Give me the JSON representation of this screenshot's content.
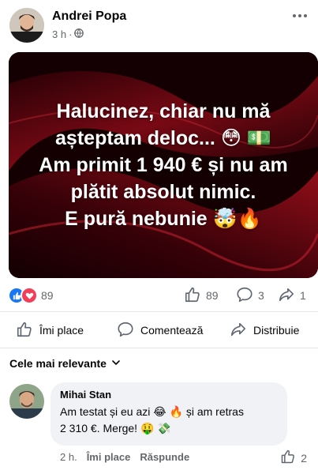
{
  "post": {
    "author": "Andrei Popa",
    "time": "3 h",
    "separator": "·",
    "image_text": {
      "line1": "Halucinez, chiar nu mă",
      "line2": "așteptam deloc... 😳 💵",
      "line3": "Am primit 1 940 € și nu am",
      "line4": "plătit absolut nimic.",
      "line5": "E pură nebunie 🤯🔥"
    },
    "reactions_count": "89",
    "likes_count": "89",
    "comments_count": "3",
    "shares_count": "1"
  },
  "actions": {
    "like": "Îmi place",
    "comment": "Comentează",
    "share": "Distribuie"
  },
  "comments": {
    "sort_label": "Cele mai relevante",
    "items": [
      {
        "author": "Mihai Stan",
        "line1": "Am testat și eu azi 😂 🔥 și am retras",
        "line2": "2 310 €. Merge! 🤑 💸",
        "time": "2 h.",
        "like_label": "Îmi place",
        "reply_label": "Răspunde",
        "likes": "2"
      }
    ]
  },
  "colors": {
    "accent_blue": "#1877f2",
    "love_red": "#f33e58",
    "secondary_text": "#65676b",
    "bubble_bg": "#f0f2f5",
    "image_bg": "#1a0003"
  },
  "icons": [
    "globe-icon",
    "more-icon",
    "like-reaction-icon",
    "love-reaction-icon",
    "thumb-up-icon",
    "comment-icon",
    "share-icon",
    "chevron-down-icon"
  ]
}
